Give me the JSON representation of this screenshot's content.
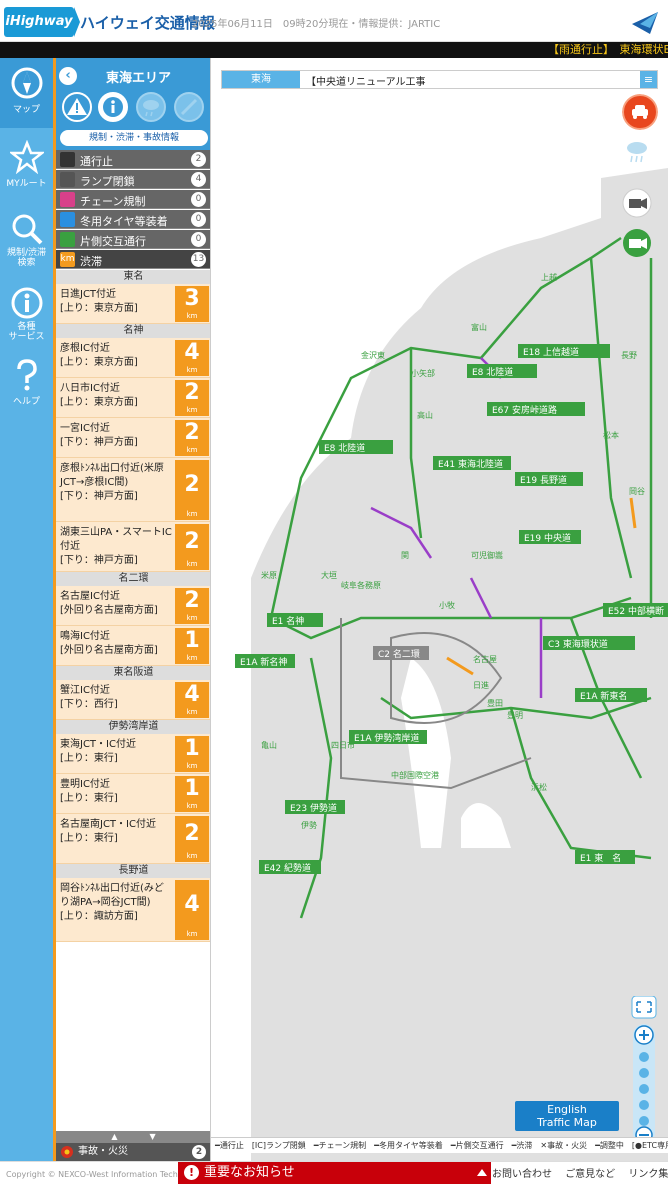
{
  "header": {
    "logo": "iHighway",
    "title": "ハイウェイ交通情報",
    "timestamp": "2025年06月11日　09時20分現在・情報提供：JARTIC",
    "brand": "NEXCO"
  },
  "ticker": "【雨通行止】　東海環状E",
  "nav": [
    {
      "label": "マップ",
      "icon": "compass-icon"
    },
    {
      "label": "MYルート",
      "icon": "star-icon"
    },
    {
      "label": "規制/渋滞\n検索",
      "icon": "search-icon"
    },
    {
      "label": "各種\nサービス",
      "icon": "info-icon"
    },
    {
      "label": "ヘルプ",
      "icon": "question-icon"
    }
  ],
  "panel": {
    "back": "‹",
    "title": "東海エリア",
    "mode_label": "規制・渋滞・事故情報",
    "regulations": [
      {
        "label": "通行止",
        "count": "2",
        "icon_color": "#333333"
      },
      {
        "label": "ランプ閉鎖",
        "count": "4",
        "icon_color": "#555555"
      },
      {
        "label": "チェーン規制",
        "count": "0",
        "icon_color": "#d8408a"
      },
      {
        "label": "冬用タイヤ等装着",
        "count": "0",
        "icon_color": "#2a8fe0"
      },
      {
        "label": "片側交互通行",
        "count": "0",
        "icon_color": "#3aa040"
      }
    ],
    "jam": {
      "label": "渋滞",
      "count": "13",
      "icon": "km"
    },
    "groups": [
      {
        "road": "東名",
        "items": [
          {
            "text": "日進JCT付近\n[上り：東京方面]",
            "km": "3"
          }
        ]
      },
      {
        "road": "名神",
        "items": [
          {
            "text": "彦根IC付近\n[上り：東京方面]",
            "km": "4"
          },
          {
            "text": "八日市IC付近\n[上り：東京方面]",
            "km": "2"
          },
          {
            "text": "一宮IC付近\n[下り：神戸方面]",
            "km": "2"
          },
          {
            "text": "彦根ﾄﾝﾈﾙ出口付近(米原JCT→彦根IC間)\n[下り：神戸方面]",
            "km": "2"
          },
          {
            "text": "湖東三山PA・スマートIC付近\n[下り：神戸方面]",
            "km": "2"
          }
        ]
      },
      {
        "road": "名二環",
        "items": [
          {
            "text": "名古屋IC付近\n[外回り名古屋南方面]",
            "km": "2"
          },
          {
            "text": "鳴海IC付近\n[外回り名古屋南方面]",
            "km": "1"
          }
        ]
      },
      {
        "road": "東名阪道",
        "items": [
          {
            "text": "蟹江IC付近\n[下り：西行]",
            "km": "4"
          }
        ]
      },
      {
        "road": "伊勢湾岸道",
        "items": [
          {
            "text": "東海JCT・IC付近\n[上り：東行]",
            "km": "1"
          },
          {
            "text": "豊明IC付近\n[上り：東行]",
            "km": "1"
          },
          {
            "text": "名古屋南JCT・IC付近\n[上り：東行]",
            "km": "2"
          }
        ]
      },
      {
        "road": "長野道",
        "items": [
          {
            "text": "岡谷ﾄﾝﾈﾙ出口付近(みどり湖PA→岡谷JCT間)\n[上り：諏訪方面]",
            "km": "4"
          }
        ]
      }
    ],
    "km_unit": "km",
    "footer": {
      "scroll": "▲　　　　▼",
      "fire_label": "事故・火災",
      "fire_count": "2"
    }
  },
  "map": {
    "area": "東海",
    "news": "【中央道リニューアル工事",
    "english_btn": "English\nTraffic Map",
    "road_labels": [
      {
        "code": "E18",
        "name": "上信越道"
      },
      {
        "code": "E8",
        "name": "北陸道"
      },
      {
        "code": "E67",
        "name": "安房峠道路"
      },
      {
        "code": "E41",
        "name": "東海北陸道"
      },
      {
        "code": "E19",
        "name": "長野道"
      },
      {
        "code": "E8",
        "name": "北陸道"
      },
      {
        "code": "E19",
        "name": "中央道"
      },
      {
        "code": "E52",
        "name": "中部横断"
      },
      {
        "code": "C3",
        "name": "東海環状道"
      },
      {
        "code": "E1",
        "name": "名神"
      },
      {
        "code": "C2",
        "name": "名二環"
      },
      {
        "code": "E1A",
        "name": "新名神"
      },
      {
        "code": "E1A",
        "name": "新東名"
      },
      {
        "code": "E1A",
        "name": "伊勢湾岸道"
      },
      {
        "code": "E23",
        "name": "伊勢道"
      },
      {
        "code": "E42",
        "name": "紀勢道"
      },
      {
        "code": "E1",
        "name": "東　名"
      }
    ],
    "places": [
      "金沢東",
      "小矢部",
      "富山",
      "上越",
      "長野",
      "松本",
      "岡谷",
      "高山",
      "関",
      "可児御嵩",
      "名古屋",
      "小牧",
      "四日市",
      "亀山",
      "伊勢",
      "浜松",
      "豊田",
      "岐阜各務原",
      "米原",
      "大垣",
      "日進",
      "豊明",
      "中部国際空港"
    ]
  },
  "legend": "━通行止　[IC]ランプ閉鎖　━チェーン規制　━冬用タイヤ等装着　━片側交互通行　━渋滞　✕事故・火災　━調整中　[●ETC専用",
  "footer": {
    "copyright": "Copyright © NEXCO-West Information Technology",
    "notice": "重要なお知らせ",
    "links": [
      "お問い合わせ",
      "ご意見など",
      "リンク集"
    ]
  }
}
